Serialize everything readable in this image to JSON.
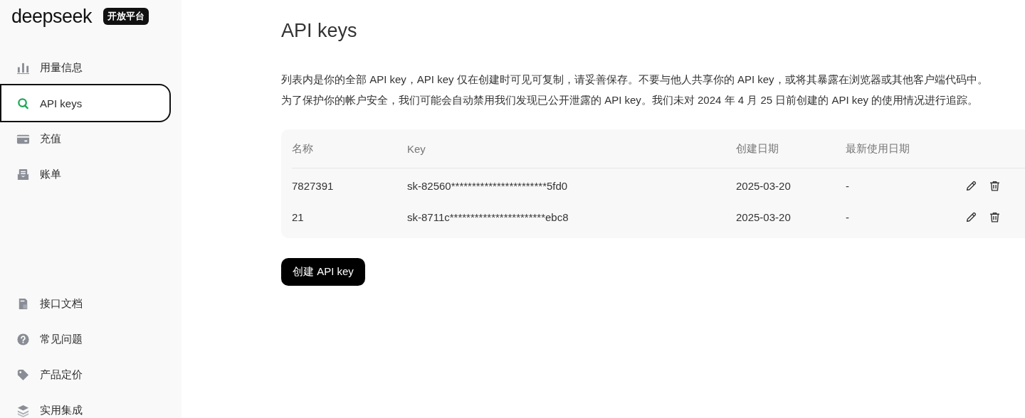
{
  "brand": {
    "logo": "deepseek",
    "badge": "开放平台"
  },
  "nav_top": [
    {
      "label": "用量信息",
      "selected": false
    },
    {
      "label": "API keys",
      "selected": true
    },
    {
      "label": "充值",
      "selected": false
    },
    {
      "label": "账单",
      "selected": false
    }
  ],
  "nav_bottom": [
    {
      "label": "接口文档",
      "selected": false
    },
    {
      "label": "常见问题",
      "selected": false
    },
    {
      "label": "产品定价",
      "selected": false
    },
    {
      "label": "实用集成",
      "selected": false
    }
  ],
  "page": {
    "title": "API keys",
    "description": [
      "列表内是你的全部 API key，API key 仅在创建时可见可复制，请妥善保存。不要与他人共享你的 API key，或将其暴露在浏览器或其他客户端代码中。",
      "为了保护你的帐户安全，我们可能会自动禁用我们发现已公开泄露的 API key。我们未对 2024 年 4 月 25 日前创建的 API key 的使用情况进行追踪。"
    ]
  },
  "table": {
    "columns": [
      "名称",
      "Key",
      "创建日期",
      "最新使用日期"
    ],
    "rows": [
      {
        "name": "7827391",
        "key": "sk-82560***********************5fd0",
        "created": "2025-03-20",
        "last_used": "-"
      },
      {
        "name": "21",
        "key": "sk-8711c***********************ebc8",
        "created": "2025-03-20",
        "last_used": "-"
      }
    ]
  },
  "create_button": "创建 API key"
}
